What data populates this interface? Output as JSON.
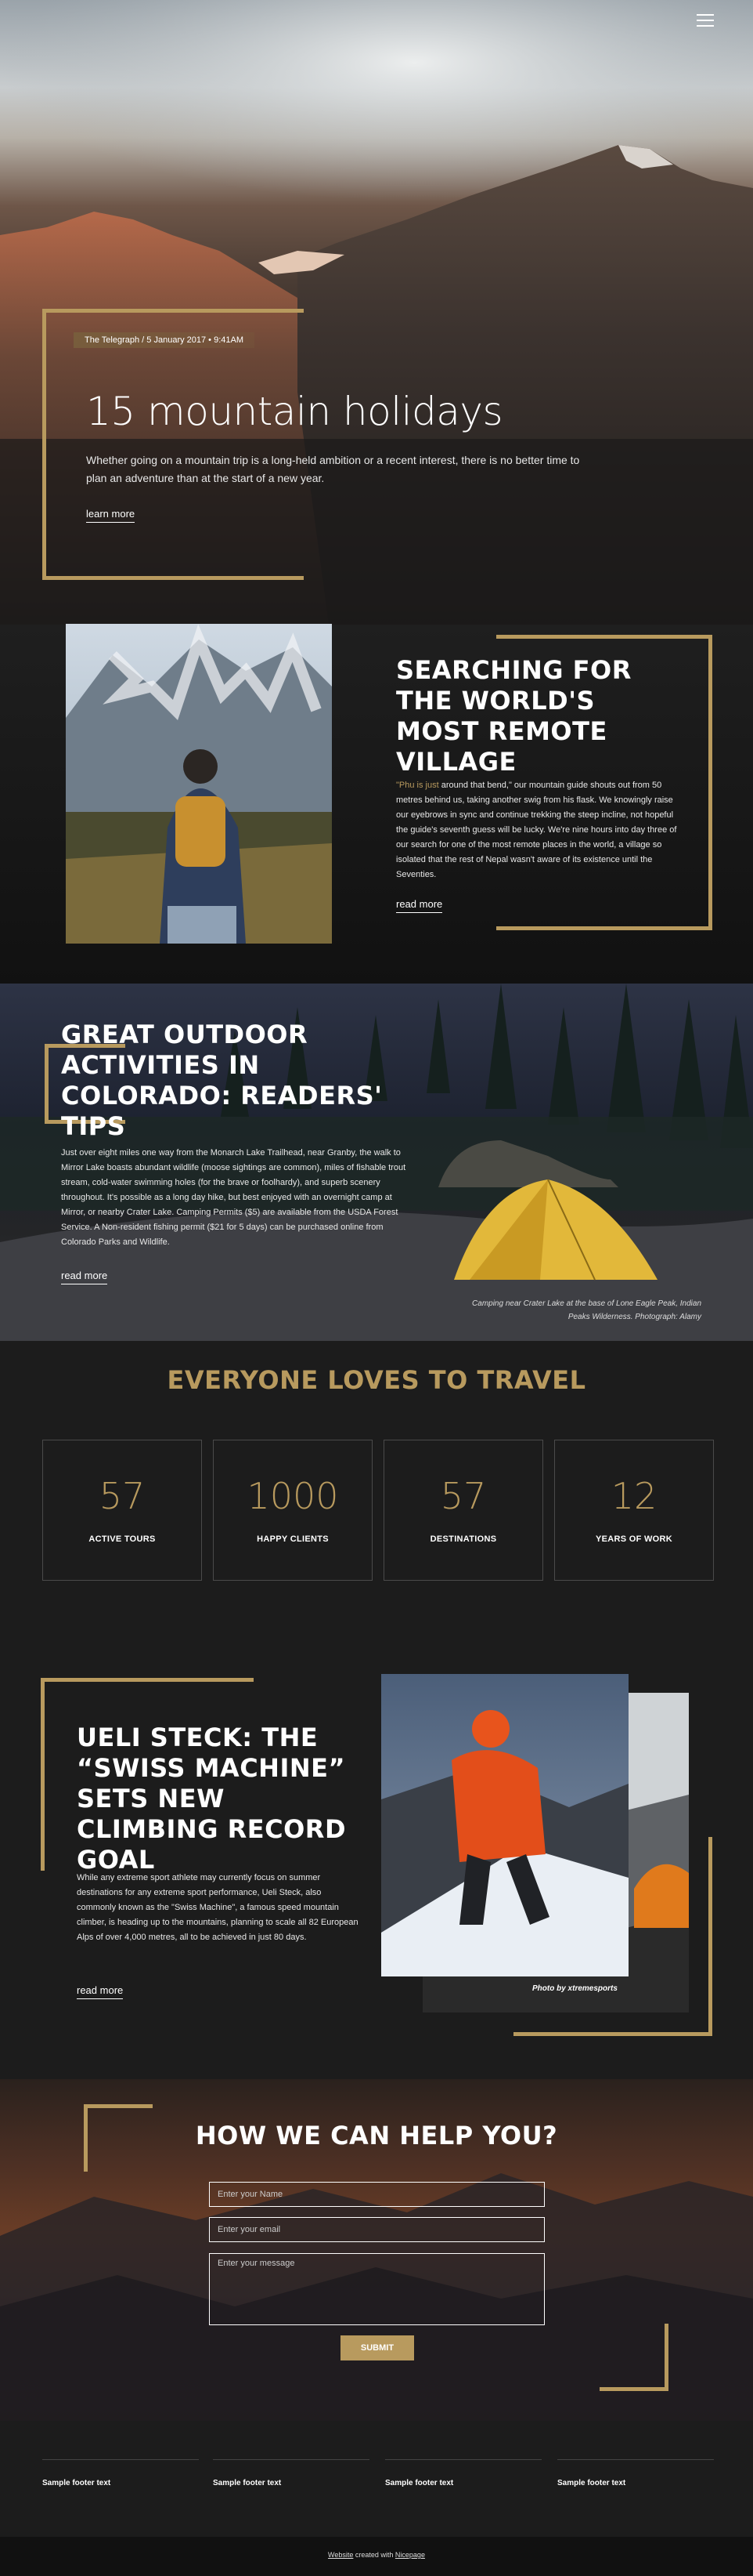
{
  "nav": {
    "menu_icon": "hamburger-icon"
  },
  "hero": {
    "dateline": "The Telegraph / 5 January 2017 • 9:41AM",
    "title": "15 mountain holidays",
    "text": "Whether going on a mountain trip is a long-held ambition or a recent interest, there is no better time to plan an adventure than at the start of a new year.",
    "link": "learn more"
  },
  "village": {
    "title": "SEARCHING FOR THE WORLD'S MOST REMOTE VILLAGE",
    "text_highlight": "\"Phu is just",
    "text": " around that bend,\" our mountain guide shouts out from 50 metres behind us, taking another swig from his flask. We knowingly raise our eyebrows in sync and continue trekking the steep incline, not hopeful the guide's seventh guess will be lucky. We're nine hours into day three of our search for one of the most remote places in the world, a village so isolated that the rest of Nepal wasn't aware of its existence until the Seventies.",
    "link": "read more"
  },
  "colorado": {
    "title": "GREAT OUTDOOR ACTIVITIES IN COLORADO: READERS' TIPS",
    "text": "Just over eight miles one way from the Monarch Lake Trailhead, near Granby, the walk to Mirror Lake boasts abundant wildlife (moose sightings are common), miles of fishable trout stream, cold-water swimming holes (for the brave or foolhardy), and superb scenery throughout. It's possible as a long day hike, but best enjoyed with an overnight camp at Mirror, or nearby Crater Lake. Camping Permits ($5) are available from the USDA Forest Service. A Non-resident fishing permit ($21 for 5 days) can be purchased online from Colorado Parks and Wildlife.",
    "link": "read more",
    "caption": "Camping near Crater Lake at the base of Lone Eagle Peak, Indian Peaks Wilderness. Photograph: Alamy"
  },
  "stats": {
    "title": "EVERYONE LOVES TO TRAVEL",
    "items": [
      {
        "number": "57",
        "label": "ACTIVE TOURS"
      },
      {
        "number": "1000",
        "label": "HAPPY CLIENTS"
      },
      {
        "number": "57",
        "label": "DESTINATIONS"
      },
      {
        "number": "12",
        "label": "YEARS OF WORK"
      }
    ]
  },
  "ueli": {
    "title": "UELI STECK: THE “SWISS MACHINE” SETS NEW CLIMBING RECORD GOAL",
    "text": "While any extreme sport athlete may currently focus on summer destinations for any extreme sport performance, Ueli Steck, also commonly known as the \"Swiss Machine\", a famous speed mountain climber, is heading up to the mountains, planning to scale all 82 European Alps of over 4,000 metres, all to be achieved in just 80 days.",
    "link": "read more",
    "credit": "Photo  by  xtremesports"
  },
  "help": {
    "title": "HOW WE CAN HELP YOU?",
    "name_placeholder": "Enter your Name",
    "email_placeholder": "Enter your email",
    "message_placeholder": "Enter your message",
    "submit": "SUBMIT"
  },
  "footer": {
    "columns": [
      "Sample footer text",
      "Sample footer text",
      "Sample footer text",
      "Sample footer text"
    ],
    "copyright_a": "Website",
    "copyright_b": " created with ",
    "copyright_c": "Nicepage"
  },
  "colors": {
    "accent": "#b89a5e",
    "background": "#1c1c1c"
  }
}
